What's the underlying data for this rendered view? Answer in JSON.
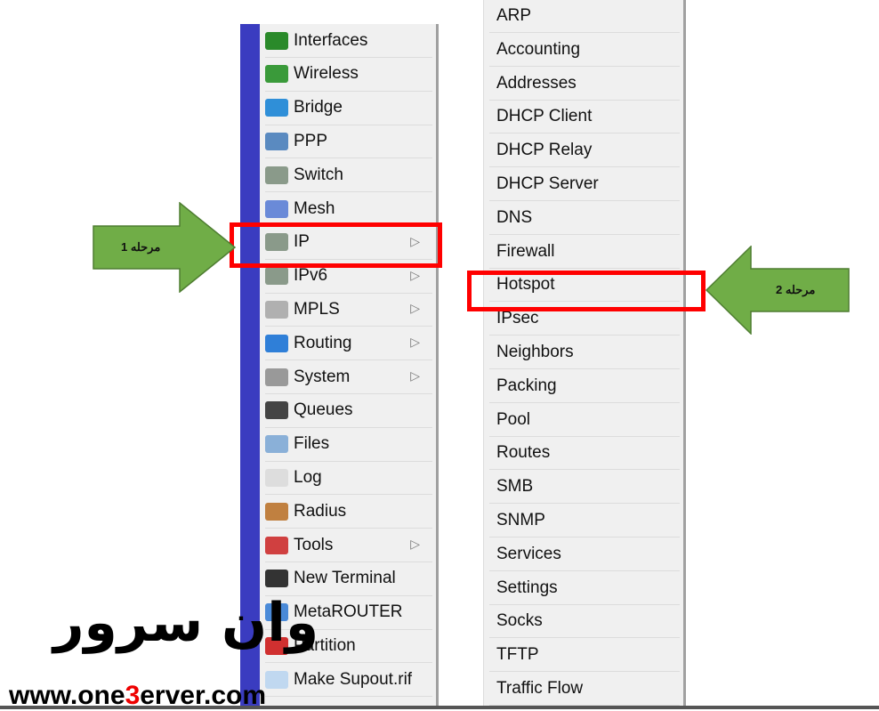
{
  "left_menu": {
    "items": [
      {
        "label": "Interfaces",
        "icon": "interfaces-icon",
        "color": "#2a8a2a",
        "submenu": false
      },
      {
        "label": "Wireless",
        "icon": "wireless-icon",
        "color": "#3a9a3a",
        "submenu": false
      },
      {
        "label": "Bridge",
        "icon": "bridge-icon",
        "color": "#2f8fd8",
        "submenu": false
      },
      {
        "label": "PPP",
        "icon": "ppp-icon",
        "color": "#5a8ac0",
        "submenu": false
      },
      {
        "label": "Switch",
        "icon": "switch-icon",
        "color": "#8a9a8a",
        "submenu": false
      },
      {
        "label": "Mesh",
        "icon": "mesh-icon",
        "color": "#6a8ad8",
        "submenu": false
      },
      {
        "label": "IP",
        "icon": "ip-icon",
        "color": "#8a9a8a",
        "submenu": true
      },
      {
        "label": "IPv6",
        "icon": "ipv6-icon",
        "color": "#8a9a8a",
        "submenu": true
      },
      {
        "label": "MPLS",
        "icon": "mpls-icon",
        "color": "#b0b0b0",
        "submenu": true
      },
      {
        "label": "Routing",
        "icon": "routing-icon",
        "color": "#2f7fd8",
        "submenu": true
      },
      {
        "label": "System",
        "icon": "system-icon",
        "color": "#999999",
        "submenu": true
      },
      {
        "label": "Queues",
        "icon": "queues-icon",
        "color": "#444444",
        "submenu": false
      },
      {
        "label": "Files",
        "icon": "files-icon",
        "color": "#8ab0d8",
        "submenu": false
      },
      {
        "label": "Log",
        "icon": "log-icon",
        "color": "#dddddd",
        "submenu": false
      },
      {
        "label": "Radius",
        "icon": "radius-icon",
        "color": "#c08040",
        "submenu": false
      },
      {
        "label": "Tools",
        "icon": "tools-icon",
        "color": "#d04040",
        "submenu": true
      },
      {
        "label": "New Terminal",
        "icon": "terminal-icon",
        "color": "#333333",
        "submenu": false
      },
      {
        "label": "MetaROUTER",
        "icon": "metarouter-icon",
        "color": "#4a8ad8",
        "submenu": false
      },
      {
        "label": "Partition",
        "icon": "partition-icon",
        "color": "#d03030",
        "submenu": false
      },
      {
        "label": "Make Supout.rif",
        "icon": "supout-icon",
        "color": "#c0d8f0",
        "submenu": false
      }
    ],
    "submenu_glyph": "▷"
  },
  "right_menu": {
    "items": [
      "ARP",
      "Accounting",
      "Addresses",
      "DHCP Client",
      "DHCP Relay",
      "DHCP Server",
      "DNS",
      "Firewall",
      "Hotspot",
      "IPsec",
      "Neighbors",
      "Packing",
      "Pool",
      "Routes",
      "SMB",
      "SNMP",
      "Services",
      "Settings",
      "Socks",
      "TFTP",
      "Traffic Flow"
    ]
  },
  "annotations": {
    "step1": "مرحله 1",
    "step2": "مرحله 2",
    "arrow_color": "#70ad47",
    "highlight_color": "#ff0000"
  },
  "watermark": {
    "site_pre": "www.one",
    "site_mid": "3",
    "site_post": "erver.com",
    "logo_fa": "وان سرور"
  }
}
